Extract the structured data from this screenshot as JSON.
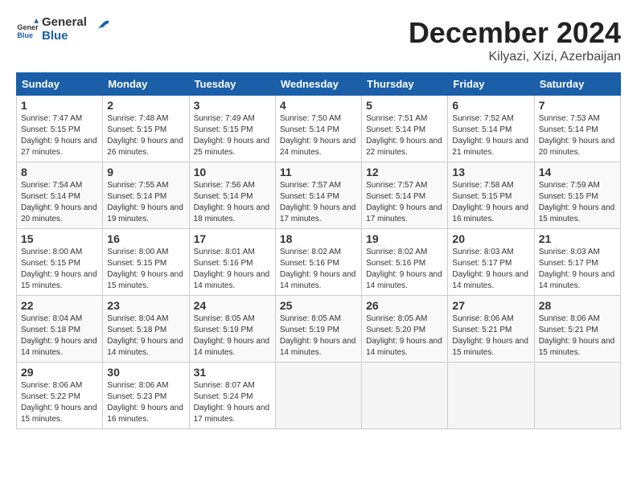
{
  "header": {
    "logo_general": "General",
    "logo_blue": "Blue",
    "month_title": "December 2024",
    "location": "Kilyazi, Xizi, Azerbaijan"
  },
  "calendar": {
    "weekdays": [
      "Sunday",
      "Monday",
      "Tuesday",
      "Wednesday",
      "Thursday",
      "Friday",
      "Saturday"
    ],
    "weeks": [
      [
        null,
        null,
        null,
        null,
        null,
        null,
        null
      ]
    ],
    "days": {
      "1": {
        "sunrise": "7:47 AM",
        "sunset": "5:15 PM",
        "daylight": "9 hours and 27 minutes."
      },
      "2": {
        "sunrise": "7:48 AM",
        "sunset": "5:15 PM",
        "daylight": "9 hours and 26 minutes."
      },
      "3": {
        "sunrise": "7:49 AM",
        "sunset": "5:15 PM",
        "daylight": "9 hours and 25 minutes."
      },
      "4": {
        "sunrise": "7:50 AM",
        "sunset": "5:14 PM",
        "daylight": "9 hours and 24 minutes."
      },
      "5": {
        "sunrise": "7:51 AM",
        "sunset": "5:14 PM",
        "daylight": "9 hours and 22 minutes."
      },
      "6": {
        "sunrise": "7:52 AM",
        "sunset": "5:14 PM",
        "daylight": "9 hours and 21 minutes."
      },
      "7": {
        "sunrise": "7:53 AM",
        "sunset": "5:14 PM",
        "daylight": "9 hours and 20 minutes."
      },
      "8": {
        "sunrise": "7:54 AM",
        "sunset": "5:14 PM",
        "daylight": "9 hours and 20 minutes."
      },
      "9": {
        "sunrise": "7:55 AM",
        "sunset": "5:14 PM",
        "daylight": "9 hours and 19 minutes."
      },
      "10": {
        "sunrise": "7:56 AM",
        "sunset": "5:14 PM",
        "daylight": "9 hours and 18 minutes."
      },
      "11": {
        "sunrise": "7:57 AM",
        "sunset": "5:14 PM",
        "daylight": "9 hours and 17 minutes."
      },
      "12": {
        "sunrise": "7:57 AM",
        "sunset": "5:14 PM",
        "daylight": "9 hours and 17 minutes."
      },
      "13": {
        "sunrise": "7:58 AM",
        "sunset": "5:15 PM",
        "daylight": "9 hours and 16 minutes."
      },
      "14": {
        "sunrise": "7:59 AM",
        "sunset": "5:15 PM",
        "daylight": "9 hours and 15 minutes."
      },
      "15": {
        "sunrise": "8:00 AM",
        "sunset": "5:15 PM",
        "daylight": "9 hours and 15 minutes."
      },
      "16": {
        "sunrise": "8:00 AM",
        "sunset": "5:15 PM",
        "daylight": "9 hours and 15 minutes."
      },
      "17": {
        "sunrise": "8:01 AM",
        "sunset": "5:16 PM",
        "daylight": "9 hours and 14 minutes."
      },
      "18": {
        "sunrise": "8:02 AM",
        "sunset": "5:16 PM",
        "daylight": "9 hours and 14 minutes."
      },
      "19": {
        "sunrise": "8:02 AM",
        "sunset": "5:16 PM",
        "daylight": "9 hours and 14 minutes."
      },
      "20": {
        "sunrise": "8:03 AM",
        "sunset": "5:17 PM",
        "daylight": "9 hours and 14 minutes."
      },
      "21": {
        "sunrise": "8:03 AM",
        "sunset": "5:17 PM",
        "daylight": "9 hours and 14 minutes."
      },
      "22": {
        "sunrise": "8:04 AM",
        "sunset": "5:18 PM",
        "daylight": "9 hours and 14 minutes."
      },
      "23": {
        "sunrise": "8:04 AM",
        "sunset": "5:18 PM",
        "daylight": "9 hours and 14 minutes."
      },
      "24": {
        "sunrise": "8:05 AM",
        "sunset": "5:19 PM",
        "daylight": "9 hours and 14 minutes."
      },
      "25": {
        "sunrise": "8:05 AM",
        "sunset": "5:19 PM",
        "daylight": "9 hours and 14 minutes."
      },
      "26": {
        "sunrise": "8:05 AM",
        "sunset": "5:20 PM",
        "daylight": "9 hours and 14 minutes."
      },
      "27": {
        "sunrise": "8:06 AM",
        "sunset": "5:21 PM",
        "daylight": "9 hours and 15 minutes."
      },
      "28": {
        "sunrise": "8:06 AM",
        "sunset": "5:21 PM",
        "daylight": "9 hours and 15 minutes."
      },
      "29": {
        "sunrise": "8:06 AM",
        "sunset": "5:22 PM",
        "daylight": "9 hours and 15 minutes."
      },
      "30": {
        "sunrise": "8:06 AM",
        "sunset": "5:23 PM",
        "daylight": "9 hours and 16 minutes."
      },
      "31": {
        "sunrise": "8:07 AM",
        "sunset": "5:24 PM",
        "daylight": "9 hours and 17 minutes."
      }
    }
  }
}
